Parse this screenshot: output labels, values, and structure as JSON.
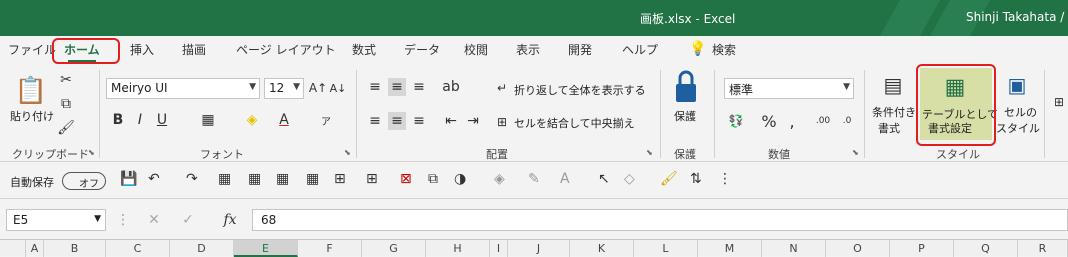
{
  "titlebar": {
    "filename": "画板.xlsx  -  Excel",
    "user": "Shinji Takahata /"
  },
  "tabs": [
    {
      "label": "ファイル"
    },
    {
      "label": "ホーム"
    },
    {
      "label": "挿入"
    },
    {
      "label": "描画"
    },
    {
      "label": "ページ レイアウト"
    },
    {
      "label": "数式"
    },
    {
      "label": "データ"
    },
    {
      "label": "校閲"
    },
    {
      "label": "表示"
    },
    {
      "label": "開発"
    },
    {
      "label": "ヘルプ"
    },
    {
      "label": "検索"
    }
  ],
  "ribbon": {
    "clipboard": {
      "paste_label": "貼り付け",
      "group_label": "クリップボード"
    },
    "font": {
      "font_name": "Meiryo UI",
      "font_size": "12",
      "group_label": "フォント"
    },
    "alignment": {
      "wrap_label": "折り返して全体を表示する",
      "merge_label": "セルを結合して中央揃え",
      "group_label": "配置"
    },
    "protect": {
      "label": "保護",
      "group_label": "保護"
    },
    "number": {
      "format": "標準",
      "group_label": "数値"
    },
    "styles": {
      "cond_line1": "条件付き",
      "cond_line2": "書式",
      "table_line1": "テーブルとして",
      "table_line2": "書式設定",
      "cell_line1": "セルの",
      "cell_line2": "スタイル",
      "group_label": "スタイル"
    }
  },
  "qat": {
    "autosave_label": "自動保存",
    "autosave_state": "オフ"
  },
  "formula_bar": {
    "cell_ref": "E5",
    "value": "68",
    "fx": "fx"
  },
  "columns": [
    "A",
    "B",
    "C",
    "D",
    "E",
    "F",
    "G",
    "H",
    "I",
    "J",
    "K",
    "L",
    "M",
    "N",
    "O",
    "P",
    "Q",
    "R"
  ],
  "selected_column": "E",
  "colors": {
    "brand": "#217346",
    "highlight": "#e0201f"
  }
}
